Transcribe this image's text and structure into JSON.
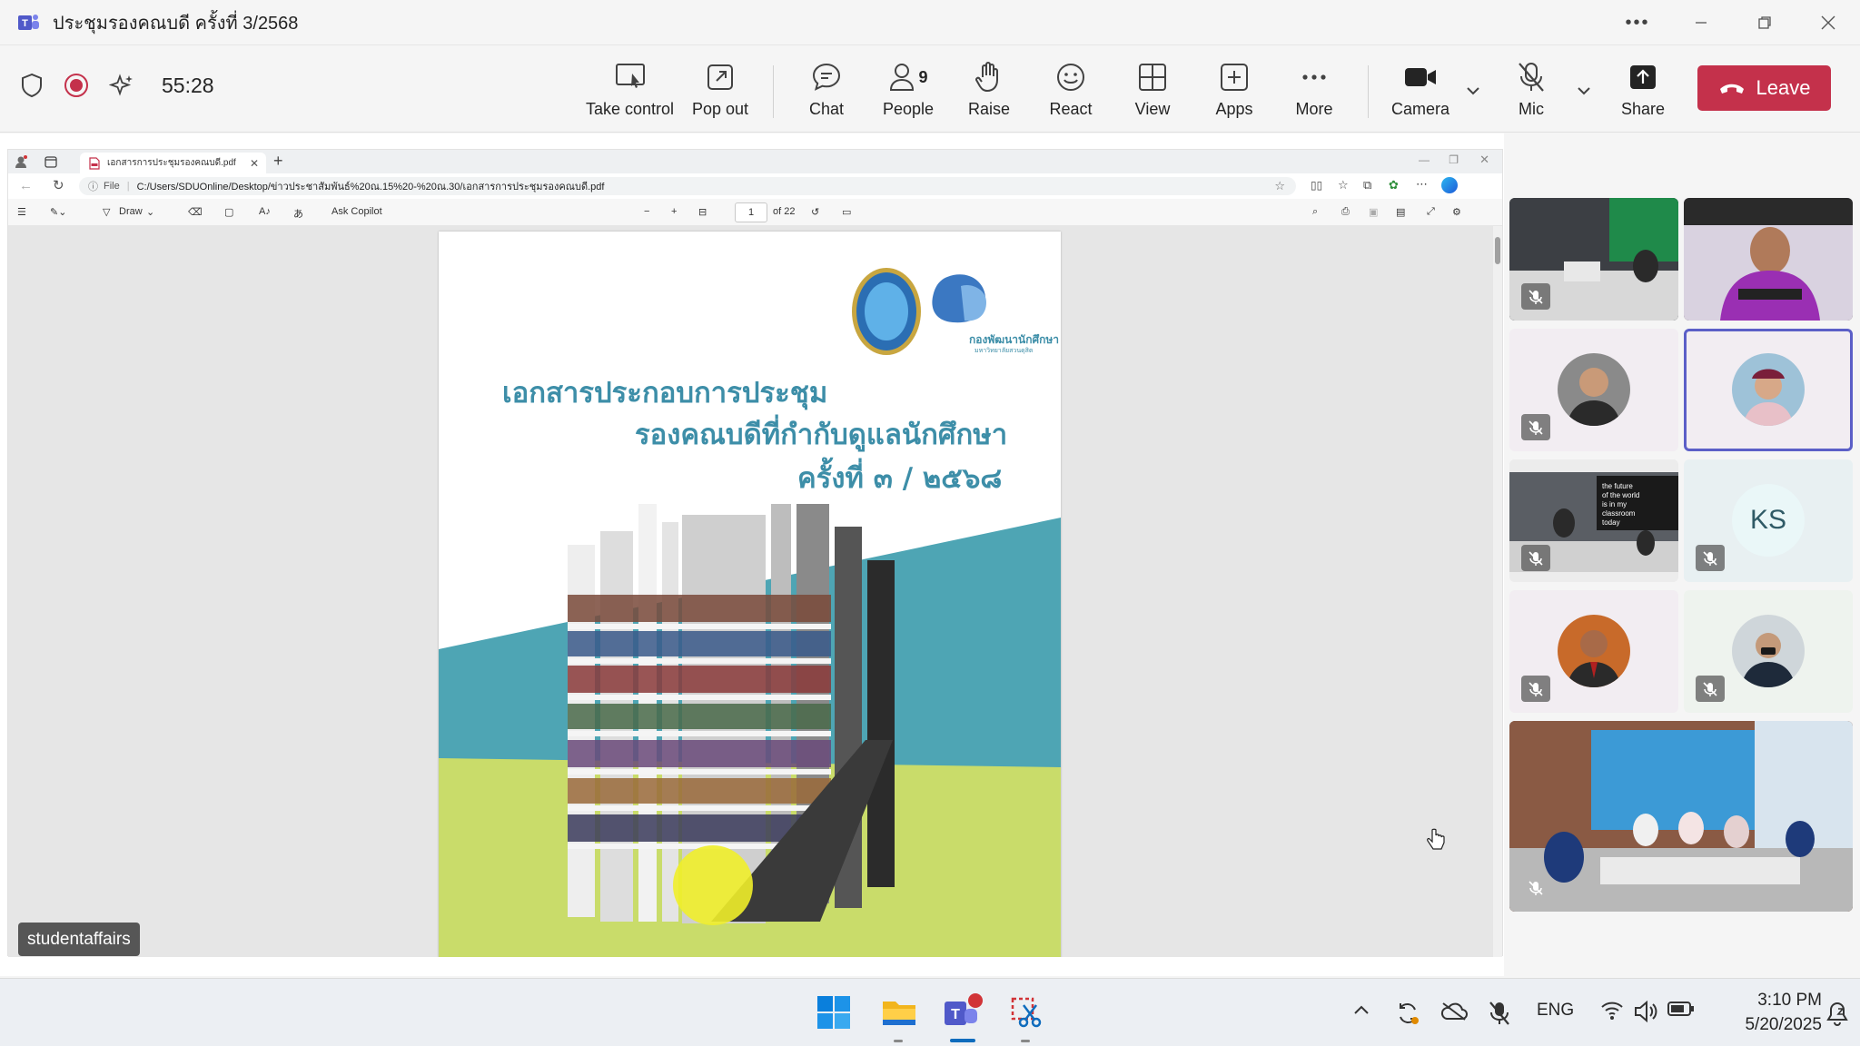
{
  "window": {
    "title": "ประชุมรองคณบดี ครั้งที่ 3/2568",
    "more_icon": "ellipsis-icon"
  },
  "toolbar": {
    "timer": "55:28",
    "buttons": {
      "take_control": "Take control",
      "pop_out": "Pop out",
      "chat": "Chat",
      "people": "People",
      "people_count": "9",
      "raise": "Raise",
      "react": "React",
      "view": "View",
      "apps": "Apps",
      "more": "More",
      "camera": "Camera",
      "mic": "Mic",
      "share": "Share",
      "leave": "Leave"
    },
    "colors": {
      "leave": "#c4314b",
      "recording": "#c4314b"
    }
  },
  "browser": {
    "tab_title": "เอกสารการประชุมรองคณบดี.pdf",
    "url_prefix": "File",
    "url": "C:/Users/SDUOnline/Desktop/ข่าวประชาสัมพันธ์%20ณ.15%20-%20ณ.30/เอกสารการประชุมรองคณบดี.pdf",
    "pdf_toolbar": {
      "draw": "Draw",
      "ask_copilot": "Ask Copilot",
      "current_page": "1",
      "page_total": "of 22"
    }
  },
  "document": {
    "title_line1": "เอกสารประกอบการประชุม",
    "title_line2": "รองคณบดีที่กำกับดูแลนักศึกษา",
    "title_line3": "ครั้งที่ ๓ / ๒๕๖๘",
    "logo_caption": "กองพัฒนานักศึกษา",
    "logo_subcaption": "มหาวิทยาลัยสวนดุสิต",
    "accent_teal": "#4ea5b4",
    "accent_green": "#c9dc6a"
  },
  "presenter": {
    "name": "studentaffairs"
  },
  "participants": {
    "initials_tile": "KS"
  },
  "taskbar": {
    "language": "ENG",
    "time": "3:10 PM",
    "date": "5/20/2025"
  }
}
